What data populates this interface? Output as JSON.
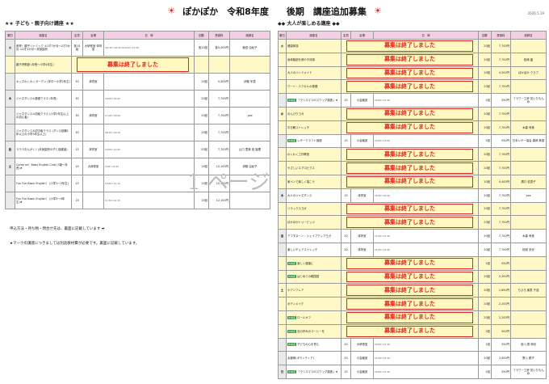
{
  "header": {
    "title": "ぽかぽか　令和8年度　　後期　講座追加募集",
    "date": "2026.5.19"
  },
  "ended_text": "募集は終了しました",
  "left": {
    "section_title": "★★ 子ども・親子向け講座 ★★",
    "cols": [
      "曜日",
      "講座名",
      "定員",
      "会場",
      "日　時",
      "回数",
      "受講料",
      "講師名"
    ],
    "rows": [
      {
        "day": "火",
        "name": "音育！親子リトミック ①1才7か月〜2才3か月 ②2才3か月〜未就園児",
        "cap": "各15組",
        "venue": "大研修室 体育室",
        "dates": "①9:45〜10:30 ②10:45〜11:30",
        "count": "各15回",
        "fee": "各5,000円",
        "teacher": "飯田 由紀子",
        "ended": false
      },
      {
        "day": "",
        "name": "親子児歌遊 (年長〜小学4年生)",
        "cap": "",
        "venue": "",
        "dates": "",
        "count": "",
        "fee": "",
        "teacher": "",
        "ended": true
      },
      {
        "day": "",
        "name": "キッズわくわくガーデン (年中〜小学2年生)",
        "cap": "20",
        "venue": "体育室",
        "dates": "",
        "count": "15回",
        "fee": "5,500円",
        "teacher": "伊藤 年恵",
        "ended": false
      },
      {
        "day": "木",
        "name": "ジャズダンス①基礎クラス (年長)",
        "cap": "30",
        "venue": "",
        "dates": "16:00〜16:45",
        "count": "20回",
        "fee": "7,700円",
        "teacher": "",
        "ended": false
      },
      {
        "day": "",
        "name": "ジャズダンス②初級クラス (小学2年生以上の初心者)",
        "cap": "30",
        "venue": "体育室",
        "dates": "17:00〜18:00",
        "count": "20回",
        "fee": "7,700円",
        "teacher": "yae",
        "ended": false
      },
      {
        "day": "",
        "name": "ジャズダンス③初中級クラス (ダンス経験1年以上の小学3年生以上)",
        "cap": "30",
        "venue": "",
        "dates": "18:15〜19:15",
        "count": "20回",
        "fee": "7,700円",
        "teacher": "",
        "ended": false
      },
      {
        "day": "金",
        "name": "ラララおんがく♪ (未就園児の子と保護者)",
        "cap": "15",
        "venue": "体育室",
        "dates": "10:00〜11:00",
        "count": "20回",
        "fee": "7,700円",
        "teacher": "山口 里美 西 謡理",
        "ended": false
      },
      {
        "day": "土",
        "name": "Come on！Baby English Club (3歳〜年長)★",
        "cap": "15",
        "venue": "大研修室",
        "dates": "9:30〜10:15",
        "count": "15回",
        "fee": "12,100円",
        "teacher": "伊藤 由紀子",
        "ended": false
      },
      {
        "day": "",
        "name": "Fun Fun Basic English！ (小学1〜2年生)",
        "cap": "15",
        "venue": "",
        "dates": "10:30〜11:15",
        "count": "15回",
        "fee": "12,100円",
        "teacher": "",
        "ended": false
      },
      {
        "day": "",
        "name": "Fun Fun Basic English！ (小学3〜4年生)★",
        "cap": "15",
        "venue": "",
        "dates": "11:30〜12:15",
        "count": "15回",
        "fee": "12,100円",
        "teacher": "",
        "ended": false
      }
    ],
    "note1": "申込方法・持ち物・問合せ先は、裏面に記載しています ➡",
    "note2": "★マークの講座につきましては別途教材費が必要です。裏面に記載しています。"
  },
  "right": {
    "section_title": "◆◆ 大人が楽しめる講座 ◆◆",
    "cols": [
      "曜日",
      "講座名",
      "定員",
      "会場",
      "日　時",
      "回数",
      "受講料",
      "講師名"
    ],
    "rows": [
      {
        "day": "火",
        "name": "健康体操",
        "ended": true,
        "count": "20回",
        "fee": "7,700円",
        "teacher": "",
        "new": false
      },
      {
        "day": "",
        "name": "身体脂肪を燃やす体操",
        "ended": true,
        "count": "20回",
        "fee": "7,700円",
        "teacher": "松崎 晶",
        "new": false
      },
      {
        "day": "",
        "name": "大人のハンドメイド",
        "ended": true,
        "count": "10回",
        "fee": "4,500円",
        "teacher": "ぽかぽか クラブ",
        "new": false
      },
      {
        "day": "",
        "name": "ワード・エクセルの基礎",
        "ended": true,
        "count": "20回",
        "fee": "7,700円",
        "teacher": "",
        "new": false
      },
      {
        "day": "",
        "name": "「クリスマスのスワッグ講座」★",
        "ended": false,
        "cap": "15",
        "venue": "小会議室",
        "dates": "10:00〜11:30",
        "count": "1回",
        "fee": "550円",
        "teacher": "フラワー工房 花いちもんめ",
        "new": true
      },
      {
        "day": "水",
        "name": "のんびりヨガ",
        "ended": true,
        "count": "20回",
        "fee": "7,700円",
        "teacher": "",
        "new": false
      },
      {
        "day": "",
        "name": "平日朝ストレッチ",
        "ended": true,
        "count": "20回",
        "fee": "7,700円",
        "teacher": "木森 有美",
        "new": false
      },
      {
        "day": "",
        "name": "レザークラフト講座",
        "ended": false,
        "cap": "15",
        "venue": "小会議室",
        "dates": "10:00〜12:00",
        "count": "1回",
        "fee": "550円",
        "teacher": "日本レザー協会 森岡 美香",
        "new": true
      },
      {
        "day": "",
        "name": "わくわく工作教室",
        "ended": true,
        "count": "20回",
        "fee": "7,700円",
        "teacher": "",
        "new": false
      },
      {
        "day": "",
        "name": "やさしいエアロビクス",
        "ended": true,
        "count": "20回",
        "fee": "7,700円",
        "teacher": "",
        "new": false
      },
      {
        "day": "",
        "name": "家ペンで楽しく描こう",
        "ended": true,
        "count": "10回",
        "fee": "4,400円",
        "teacher": "廣口 佐恵子",
        "new": false
      },
      {
        "day": "木",
        "name": "大人のジャズダンス",
        "ended": false,
        "cap": "15",
        "venue": "体育室",
        "dates": "19:30〜20:30",
        "count": "20回",
        "fee": "7,700円",
        "teacher": "yae",
        "new": false
      },
      {
        "day": "",
        "name": "リラックスヨガ",
        "ended": true,
        "count": "20回",
        "fee": "7,700円",
        "teacher": "",
        "new": false
      },
      {
        "day": "",
        "name": "ほかほかドゥービッツ",
        "ended": true,
        "count": "20回",
        "fee": "7,700円",
        "teacher": "",
        "new": false
      },
      {
        "day": "金",
        "name": "アフタヌーン・シェイプアップヨガ",
        "ended": false,
        "cap": "20",
        "venue": "体育室",
        "dates": "13:30〜14:30",
        "count": "20回",
        "fee": "7,700円",
        "teacher": "木森 有美",
        "new": false
      },
      {
        "day": "",
        "name": "楽しいチェアストレッチ",
        "ended": false,
        "cap": "20",
        "venue": "体育室",
        "dates": "14:45〜15:45",
        "count": "20回",
        "fee": "7,700円",
        "teacher": "松岡 未央",
        "new": false
      },
      {
        "day": "",
        "name": "楽しく健康に",
        "ended": true,
        "count": "1回",
        "fee": "550円",
        "teacher": "",
        "new": true
      },
      {
        "day": "",
        "name": "はじめての韓国語",
        "ended": true,
        "count": "20回",
        "fee": "2,200円",
        "teacher": "",
        "new": true
      },
      {
        "day": "土",
        "name": "ケアンフレア",
        "ended": true,
        "count": "20回",
        "fee": "1,650円",
        "teacher": "ちひろ 楽恵 千浩",
        "new": false
      },
      {
        "day": "",
        "name": "ボディメイク",
        "ended": true,
        "count": "20回",
        "fee": "2,200円",
        "teacher": "",
        "new": false
      },
      {
        "day": "",
        "name": "ロールオフ",
        "ended": true,
        "count": "20回",
        "fee": "2,200円",
        "teacher": "",
        "new": true
      },
      {
        "day": "",
        "name": "自分好みのコーヒーを",
        "ended": true,
        "count": "2回",
        "fee": "500円",
        "teacher": "",
        "new": true
      },
      {
        "day": "",
        "name": "子どもの心を育む",
        "ended": false,
        "cap": "20",
        "venue": "大研修室",
        "dates": "10:00〜11:30",
        "count": "1回",
        "fee": "550円",
        "teacher": "宮川 恵 和也",
        "new": true
      },
      {
        "day": "",
        "name": "太極拳(ボランティア)",
        "ended": false,
        "cap": "20",
        "venue": "小会議室",
        "dates": "13:30〜15:30",
        "count": "20回",
        "fee": "2,000円",
        "teacher": "野入 都子",
        "new": false
      },
      {
        "day": "日",
        "name": "「クリスマスのスワッグ講座」★",
        "ended": false,
        "cap": "15",
        "venue": "小会議室",
        "dates": "10:00〜11:30",
        "count": "1回",
        "fee": "550円",
        "teacher": "フラワー工房 花いちもんめ",
        "new": true
      }
    ]
  },
  "new_badge": "新講座",
  "page_mark": "1 ページ"
}
